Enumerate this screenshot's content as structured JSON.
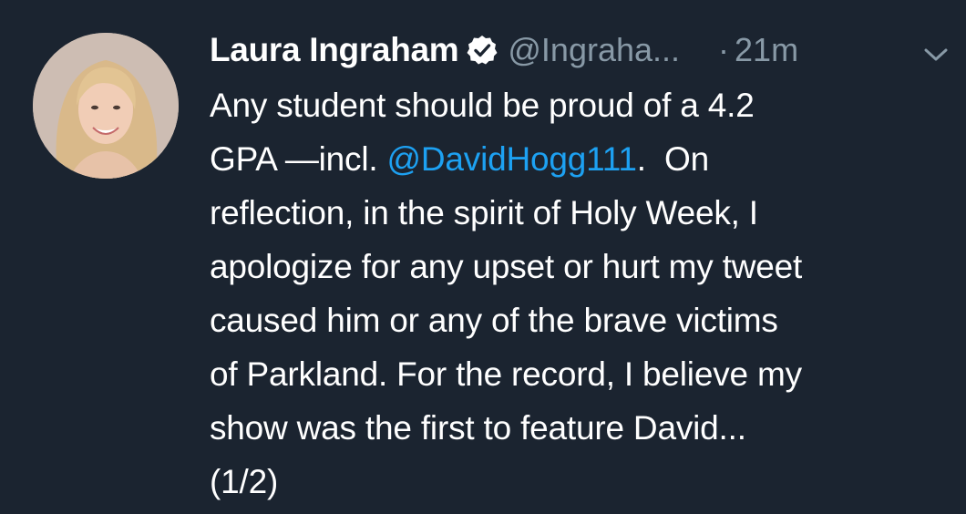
{
  "tweet": {
    "author_name": "Laura Ingraham",
    "handle": "@Ingraha...",
    "separator": "·",
    "time": "21m",
    "verified": true,
    "avatar_icon": "profile-photo",
    "menu_icon": "chevron-down-icon",
    "lines": [
      {
        "text": "Any student should be proud of a 4.2"
      },
      {
        "before": "GPA —incl. ",
        "mention": "@DavidHogg111",
        "after": ".  On"
      },
      {
        "text": "reflection, in the spirit of Holy Week, I"
      },
      {
        "text": "apologize for any upset or hurt my tweet"
      },
      {
        "text": "caused him or any of the brave victims"
      },
      {
        "text": "of Parkland. For the record, I believe my"
      },
      {
        "text": "show was the first to feature David..."
      },
      {
        "text": "(1/2)"
      }
    ]
  },
  "colors": {
    "background": "#1b2430",
    "text": "#ffffff",
    "muted": "#8899a6",
    "link": "#1da1f2"
  }
}
